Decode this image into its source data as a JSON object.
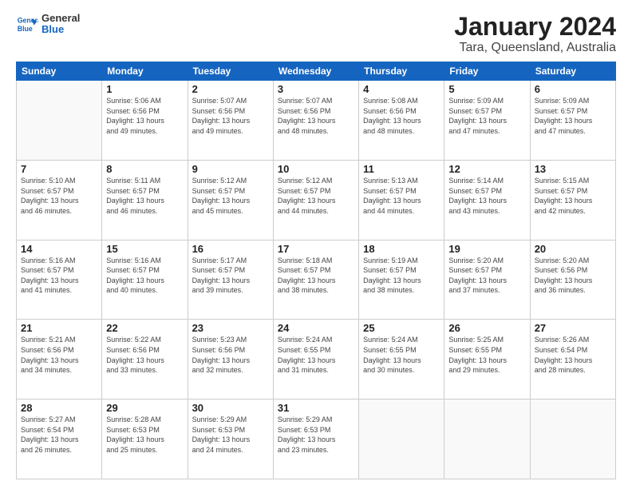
{
  "logo": {
    "line1": "General",
    "line2": "Blue"
  },
  "title": "January 2024",
  "subtitle": "Tara, Queensland, Australia",
  "weekdays": [
    "Sunday",
    "Monday",
    "Tuesday",
    "Wednesday",
    "Thursday",
    "Friday",
    "Saturday"
  ],
  "weeks": [
    [
      {
        "day": "",
        "info": ""
      },
      {
        "day": "1",
        "info": "Sunrise: 5:06 AM\nSunset: 6:56 PM\nDaylight: 13 hours\nand 49 minutes."
      },
      {
        "day": "2",
        "info": "Sunrise: 5:07 AM\nSunset: 6:56 PM\nDaylight: 13 hours\nand 49 minutes."
      },
      {
        "day": "3",
        "info": "Sunrise: 5:07 AM\nSunset: 6:56 PM\nDaylight: 13 hours\nand 48 minutes."
      },
      {
        "day": "4",
        "info": "Sunrise: 5:08 AM\nSunset: 6:56 PM\nDaylight: 13 hours\nand 48 minutes."
      },
      {
        "day": "5",
        "info": "Sunrise: 5:09 AM\nSunset: 6:57 PM\nDaylight: 13 hours\nand 47 minutes."
      },
      {
        "day": "6",
        "info": "Sunrise: 5:09 AM\nSunset: 6:57 PM\nDaylight: 13 hours\nand 47 minutes."
      }
    ],
    [
      {
        "day": "7",
        "info": ""
      },
      {
        "day": "8",
        "info": "Sunrise: 5:11 AM\nSunset: 6:57 PM\nDaylight: 13 hours\nand 46 minutes."
      },
      {
        "day": "9",
        "info": "Sunrise: 5:12 AM\nSunset: 6:57 PM\nDaylight: 13 hours\nand 45 minutes."
      },
      {
        "day": "10",
        "info": "Sunrise: 5:12 AM\nSunset: 6:57 PM\nDaylight: 13 hours\nand 44 minutes."
      },
      {
        "day": "11",
        "info": "Sunrise: 5:13 AM\nSunset: 6:57 PM\nDaylight: 13 hours\nand 44 minutes."
      },
      {
        "day": "12",
        "info": "Sunrise: 5:14 AM\nSunset: 6:57 PM\nDaylight: 13 hours\nand 43 minutes."
      },
      {
        "day": "13",
        "info": "Sunrise: 5:15 AM\nSunset: 6:57 PM\nDaylight: 13 hours\nand 42 minutes."
      }
    ],
    [
      {
        "day": "14",
        "info": ""
      },
      {
        "day": "15",
        "info": "Sunrise: 5:16 AM\nSunset: 6:57 PM\nDaylight: 13 hours\nand 40 minutes."
      },
      {
        "day": "16",
        "info": "Sunrise: 5:17 AM\nSunset: 6:57 PM\nDaylight: 13 hours\nand 39 minutes."
      },
      {
        "day": "17",
        "info": "Sunrise: 5:18 AM\nSunset: 6:57 PM\nDaylight: 13 hours\nand 38 minutes."
      },
      {
        "day": "18",
        "info": "Sunrise: 5:19 AM\nSunset: 6:57 PM\nDaylight: 13 hours\nand 38 minutes."
      },
      {
        "day": "19",
        "info": "Sunrise: 5:20 AM\nSunset: 6:57 PM\nDaylight: 13 hours\nand 37 minutes."
      },
      {
        "day": "20",
        "info": "Sunrise: 5:20 AM\nSunset: 6:56 PM\nDaylight: 13 hours\nand 36 minutes."
      }
    ],
    [
      {
        "day": "21",
        "info": ""
      },
      {
        "day": "22",
        "info": "Sunrise: 5:22 AM\nSunset: 6:56 PM\nDaylight: 13 hours\nand 33 minutes."
      },
      {
        "day": "23",
        "info": "Sunrise: 5:23 AM\nSunset: 6:56 PM\nDaylight: 13 hours\nand 32 minutes."
      },
      {
        "day": "24",
        "info": "Sunrise: 5:24 AM\nSunset: 6:55 PM\nDaylight: 13 hours\nand 31 minutes."
      },
      {
        "day": "25",
        "info": "Sunrise: 5:24 AM\nSunset: 6:55 PM\nDaylight: 13 hours\nand 30 minutes."
      },
      {
        "day": "26",
        "info": "Sunrise: 5:25 AM\nSunset: 6:55 PM\nDaylight: 13 hours\nand 29 minutes."
      },
      {
        "day": "27",
        "info": "Sunrise: 5:26 AM\nSunset: 6:54 PM\nDaylight: 13 hours\nand 28 minutes."
      }
    ],
    [
      {
        "day": "28",
        "info": "Sunrise: 5:27 AM\nSunset: 6:54 PM\nDaylight: 13 hours\nand 26 minutes."
      },
      {
        "day": "29",
        "info": "Sunrise: 5:28 AM\nSunset: 6:53 PM\nDaylight: 13 hours\nand 25 minutes."
      },
      {
        "day": "30",
        "info": "Sunrise: 5:29 AM\nSunset: 6:53 PM\nDaylight: 13 hours\nand 24 minutes."
      },
      {
        "day": "31",
        "info": "Sunrise: 5:29 AM\nSunset: 6:53 PM\nDaylight: 13 hours\nand 23 minutes."
      },
      {
        "day": "",
        "info": ""
      },
      {
        "day": "",
        "info": ""
      },
      {
        "day": "",
        "info": ""
      }
    ]
  ],
  "week1_sunday_info": "Sunrise: 5:10 AM\nSunset: 6:57 PM\nDaylight: 13 hours\nand 46 minutes.",
  "week3_sunday_info": "Sunrise: 5:16 AM\nSunset: 6:57 PM\nDaylight: 13 hours\nand 41 minutes.",
  "week4_sunday_info": "Sunrise: 5:21 AM\nSunset: 6:56 PM\nDaylight: 13 hours\nand 34 minutes."
}
